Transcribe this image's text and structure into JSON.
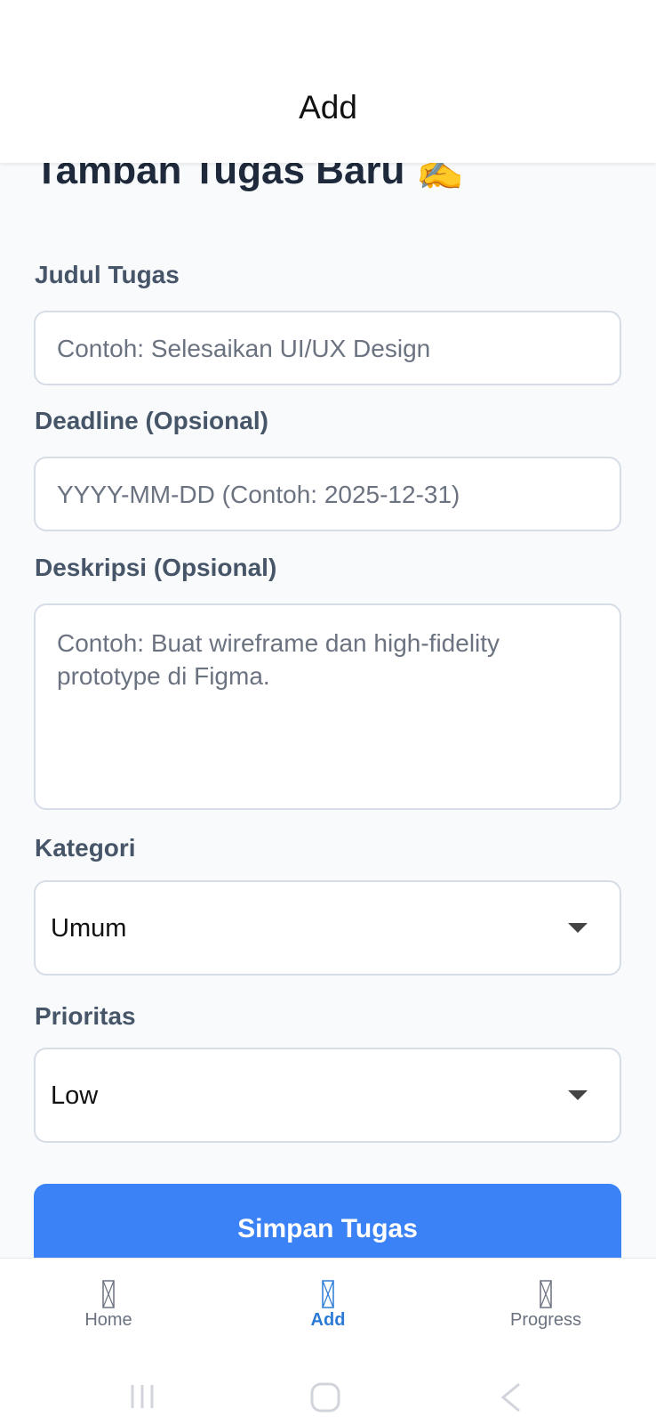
{
  "header": {
    "title": "Add"
  },
  "page": {
    "heading": "Tambah Tugas Baru ✍️"
  },
  "form": {
    "title": {
      "label": "Judul Tugas",
      "placeholder": "Contoh: Selesaikan UI/UX Design",
      "value": ""
    },
    "deadline": {
      "label": "Deadline (Opsional)",
      "placeholder": "YYYY-MM-DD (Contoh: 2025-12-31)",
      "value": ""
    },
    "description": {
      "label": "Deskripsi (Opsional)",
      "placeholder": "Contoh: Buat wireframe dan high-fidelity prototype di Figma.",
      "value": ""
    },
    "category": {
      "label": "Kategori",
      "selected": "Umum"
    },
    "priority": {
      "label": "Prioritas",
      "selected": "Low"
    },
    "save_label": "Simpan Tugas"
  },
  "nav": {
    "items": [
      {
        "label": "Home",
        "icon": "home-icon",
        "active": false
      },
      {
        "label": "Add",
        "icon": "add-icon",
        "active": true
      },
      {
        "label": "Progress",
        "icon": "progress-icon",
        "active": false
      }
    ]
  },
  "colors": {
    "accent": "#3b82f6",
    "nav_active": "#2b7bd6"
  },
  "system_nav": {
    "icons": [
      "recent-apps-icon",
      "home-button-icon",
      "back-icon"
    ]
  }
}
